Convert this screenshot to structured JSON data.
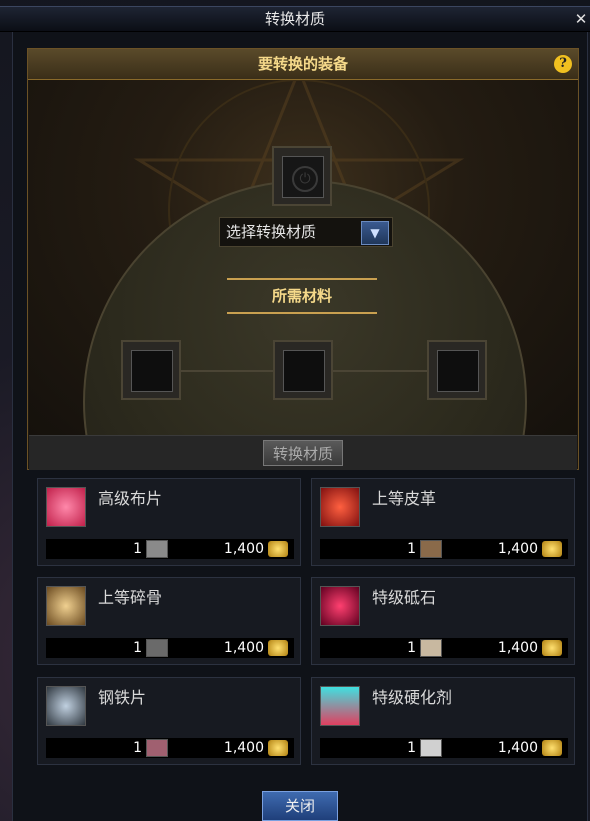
{
  "window": {
    "title": "转换材质",
    "close_glyph": "✕"
  },
  "panel": {
    "title": "要转换的装备",
    "help_glyph": "?",
    "dropdown_label": "选择转换材质",
    "dropdown_arrow": "▼",
    "required_label": "所需材料",
    "convert_button": "转换材质"
  },
  "materials": [
    {
      "name": "高级布片",
      "qty": "1",
      "price": "1,400",
      "icon": "fabric-icon",
      "color": "#e0446a"
    },
    {
      "name": "上等皮革",
      "qty": "1",
      "price": "1,400",
      "icon": "leather-icon",
      "color": "#c02a20"
    },
    {
      "name": "上等碎骨",
      "qty": "1",
      "price": "1,400",
      "icon": "bone-icon",
      "color": "#caa070"
    },
    {
      "name": "特级砥石",
      "qty": "1",
      "price": "1,400",
      "icon": "whetstone-icon",
      "color": "#b01a4a"
    },
    {
      "name": "钢铁片",
      "qty": "1",
      "price": "1,400",
      "icon": "steel-icon",
      "color": "#8090a0"
    },
    {
      "name": "特级硬化剂",
      "qty": "1",
      "price": "1,400",
      "icon": "hardener-icon",
      "color": "#40c0c0"
    }
  ],
  "footer": {
    "close_button": "关闭"
  }
}
